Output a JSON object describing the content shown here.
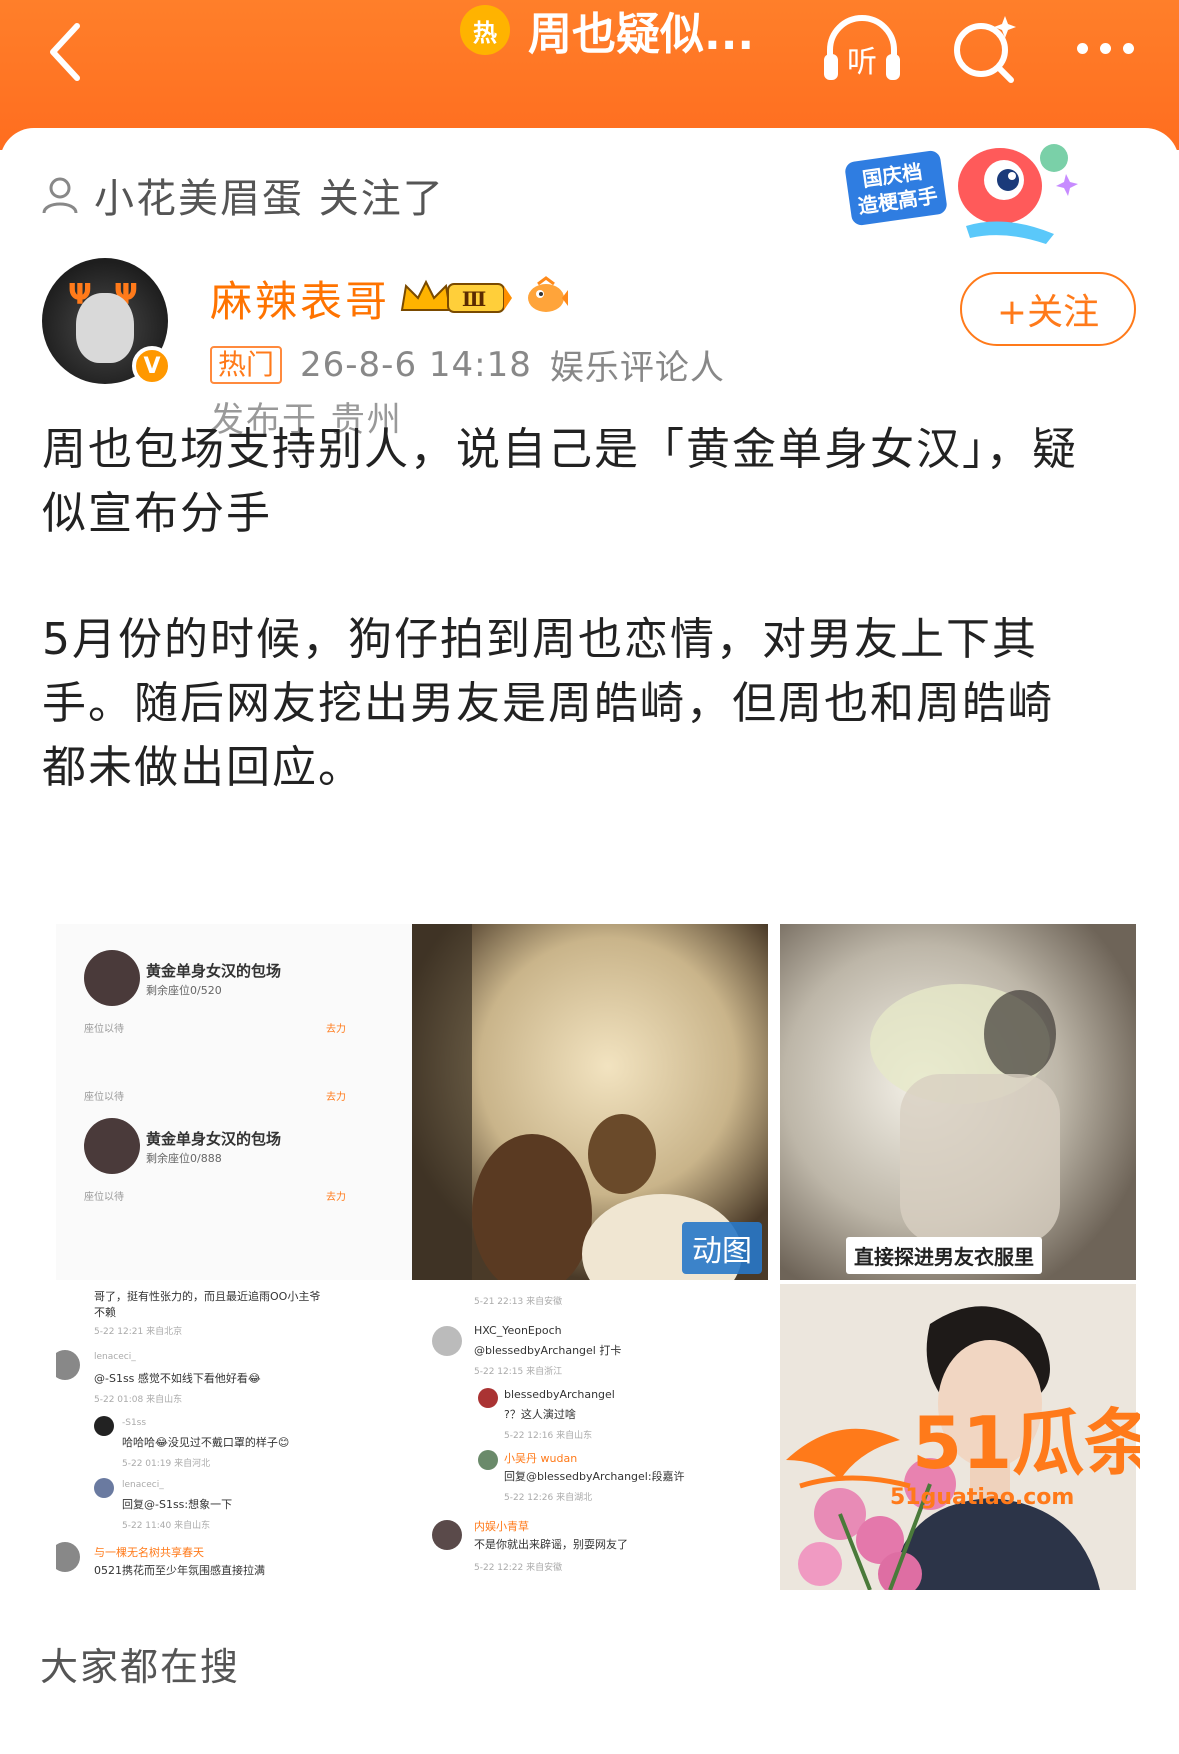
{
  "topbar": {
    "hot_glyph": "热",
    "title": "周也疑似...",
    "listen_label": "听"
  },
  "follow_notice": {
    "text": "小花美眉蛋 关注了"
  },
  "promo": {
    "line1": "国庆档",
    "line2": "造梗高手"
  },
  "author": {
    "name": "麻辣表哥",
    "level": "Ⅲ",
    "verify_glyph": "V",
    "tag": "热门",
    "time": "26-8-6 14:18",
    "source": "娱乐评论人",
    "location": "发布于 贵州",
    "follow_label": "+关注"
  },
  "post": {
    "para1": [
      "周也包场支持别人，说自己是「黄金单身女汉」，疑",
      "似宣布分手"
    ],
    "para2": [
      "5月份的时候，狗仔拍到周也恋情，对男友上下其",
      "手。随后网友挖出男友是周皓崎，但周也和周皓崎",
      "都未做出回应。"
    ]
  },
  "images": {
    "cell1": {
      "items": [
        {
          "title": "黄金单身女汉的包场",
          "sub": "剩余座位0/520",
          "foot": "座位以待",
          "go": "去力"
        },
        {
          "title": "黄金单身女汉的包场",
          "sub": "剩余座位0/888",
          "foot": "座位以待",
          "go": "去力"
        }
      ],
      "mid_foot": "座位以待",
      "mid_go": "去力"
    },
    "cell2": {
      "tag": "动图"
    },
    "cell3": {
      "caption": "直接探进男友衣服里"
    },
    "cell4": {
      "top_text": "哥了，挺有性张力的，而且最近追雨OO小主爷",
      "top_text2": "不赖",
      "top_meta": "5-22 12:21 来自北京",
      "c1_user": "lenaceci_",
      "c1_text": "@-S1ss 感觉不如线下看他好看😂",
      "c1_meta": "5-22 01:08 来自山东",
      "c2_user": "-S1ss",
      "c2_text": "哈哈哈😂没见过不戴口罩的样子😊",
      "c2_meta": "5-22 01:19 来自河北",
      "c3_user": "lenaceci_",
      "c3_text": "回复@-S1ss:想象一下",
      "c3_meta": "5-22 11:40 来自山东",
      "c4_user": "与一棵无名树共享春天",
      "c4_text": "0521携花而至少年氛围感直接拉满"
    },
    "cell5": {
      "top_meta": "5-21 22:13 来自安徽",
      "c1_user": "HXC_YeonEpoch",
      "c1_text": "@blessedbyArchangel 打卡",
      "c1_meta": "5-22 12:15 来自浙江",
      "c2_user": "blessedbyArchangel",
      "c2_text": "?？这人演过啥",
      "c2_meta": "5-22 12:16 来自山东",
      "c3_user": "小吴丹 wudan",
      "c3_text": "回复@blessedbyArchangel:段嘉许",
      "c3_meta": "5-22 12:26 来自湖北",
      "c4_user": "内娱小青草",
      "c4_text": "不是你就出来辟谣，别耍网友了",
      "c4_meta": "5-22 12:22 来自安徽"
    }
  },
  "watermark": {
    "brand": "51瓜条",
    "url": "51guatiao.com"
  },
  "section": {
    "title": "大家都在搜"
  },
  "colors": {
    "accent": "#ff7a1a",
    "topbar": "#ff7f2a"
  }
}
